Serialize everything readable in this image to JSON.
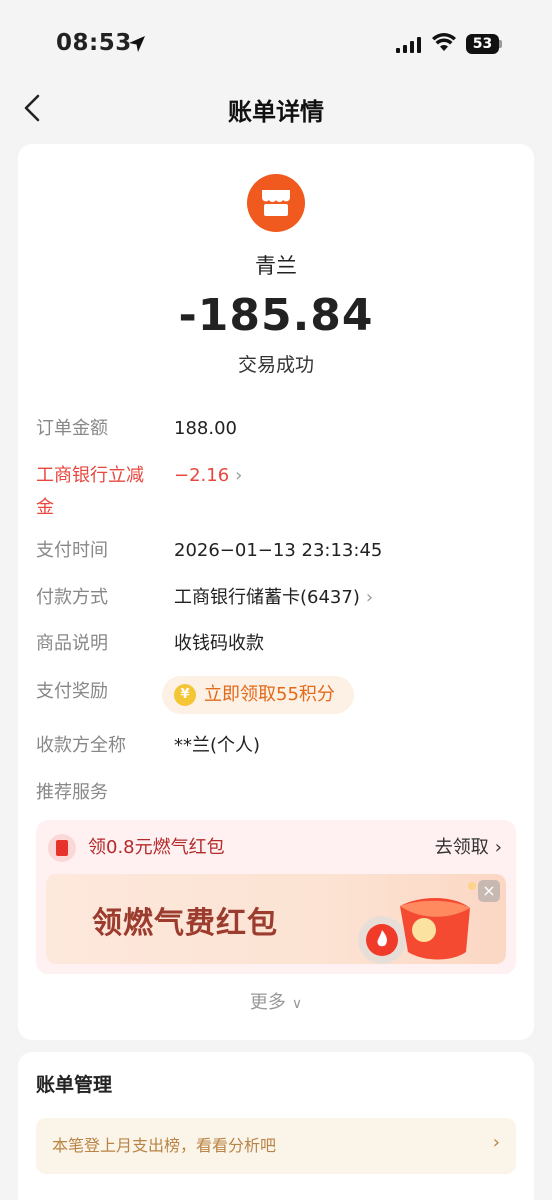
{
  "status_bar": {
    "time": "08:53",
    "battery": "53"
  },
  "nav": {
    "title": "账单详情"
  },
  "merchant": {
    "name": "青兰",
    "icon": "store-icon",
    "icon_color": "#f05a1e"
  },
  "transaction": {
    "amount": "-185.84",
    "status": "交易成功"
  },
  "details": {
    "order_amount_label": "订单金额",
    "order_amount_value": "188.00",
    "discount_label_1": "工商银行立减",
    "discount_label_2": "金",
    "discount_value": "−2.16",
    "pay_time_label": "支付时间",
    "pay_time_value": "2026−01−13 23:13:45",
    "pay_method_label": "付款方式",
    "pay_method_value": "工商银行储蓄卡(6437)",
    "goods_label": "商品说明",
    "goods_value": "收钱码收款",
    "reward_label": "支付奖励",
    "reward_value": "立即领取55积分",
    "payee_label": "收款方全称",
    "payee_value": "**兰(个人)",
    "recommend_label": "推荐服务"
  },
  "promo": {
    "title": "领0.8元燃气红包",
    "action": "去领取",
    "banner_text": "领燃气费红包"
  },
  "more": "更多",
  "bill_management": {
    "title": "账单管理",
    "analysis_text": "本笔登上月支出榜，看看分析吧"
  },
  "colors": {
    "accent_red": "#e8473f",
    "reward_orange": "#e26a1b",
    "gold_text": "#b98445"
  }
}
